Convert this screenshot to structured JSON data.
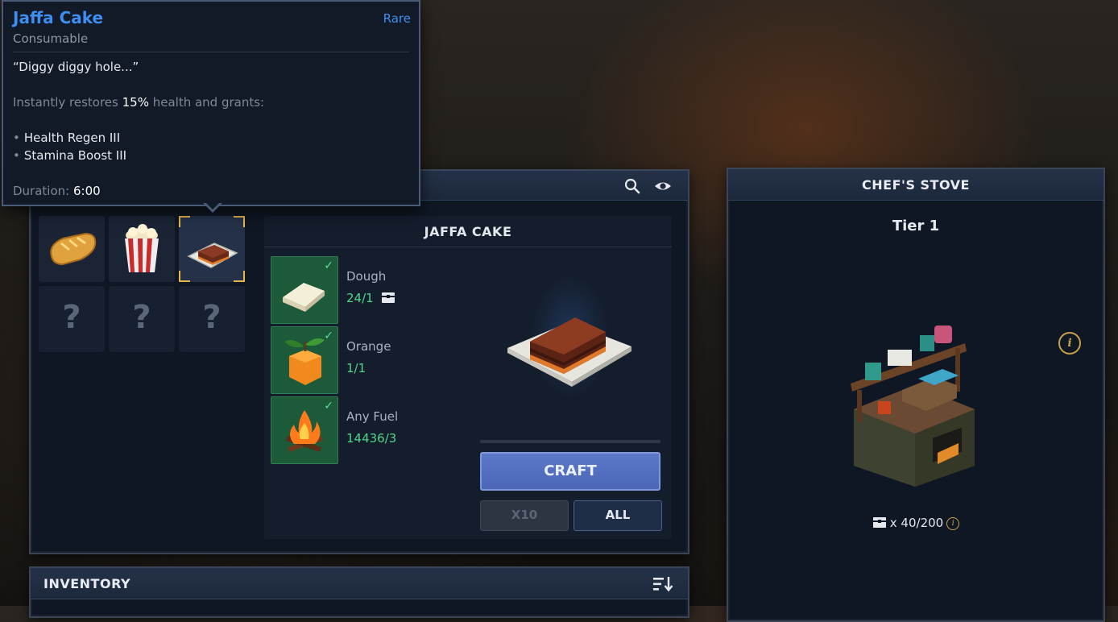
{
  "tooltip": {
    "name": "Jaffa Cake",
    "rarity": "Rare",
    "type": "Consumable",
    "quote": "“Diggy diggy hole...”",
    "desc_prefix": "Instantly restores ",
    "desc_value": "15%",
    "desc_suffix": " health and grants:",
    "effects": [
      "Health Regen III",
      "Stamina Boost III"
    ],
    "duration_label": "Duration: ",
    "duration_value": "6:00"
  },
  "craft_panel": {
    "icons": [
      "search-icon",
      "eye-icon"
    ],
    "recipes": [
      {
        "icon": "bread-icon",
        "state": "available"
      },
      {
        "icon": "popcorn-icon",
        "state": "available"
      },
      {
        "icon": "jaffa-cake-icon",
        "state": "selected"
      },
      {
        "icon": "unknown-recipe-icon",
        "label": "?",
        "state": "locked"
      },
      {
        "icon": "unknown-recipe-icon",
        "label": "?",
        "state": "locked"
      },
      {
        "icon": "unknown-recipe-icon",
        "label": "?",
        "state": "locked"
      }
    ],
    "detail": {
      "title": "JAFFA CAKE",
      "ingredients": [
        {
          "name": "Dough",
          "count": "24/1",
          "icon": "dough-icon",
          "extra_icon": "chest-icon"
        },
        {
          "name": "Orange",
          "count": "1/1",
          "icon": "orange-icon"
        },
        {
          "name": "Any Fuel",
          "count": "14436/3",
          "icon": "fire-icon"
        }
      ],
      "craft_label": "CRAFT",
      "x10_label": "X10",
      "all_label": "ALL"
    }
  },
  "inventory": {
    "title": "INVENTORY",
    "sort_icon": "sort-icon"
  },
  "stove": {
    "title": "CHEF'S STOVE",
    "tier": "Tier 1",
    "info_icon": "i",
    "storage_prefix": "x 40/200",
    "storage_icon": "chest-icon"
  },
  "colors": {
    "accent_blue": "#3e8ef0",
    "ready_green": "#4fd48a",
    "gold": "#c9a14a",
    "craft_button": "#5c78c9"
  }
}
